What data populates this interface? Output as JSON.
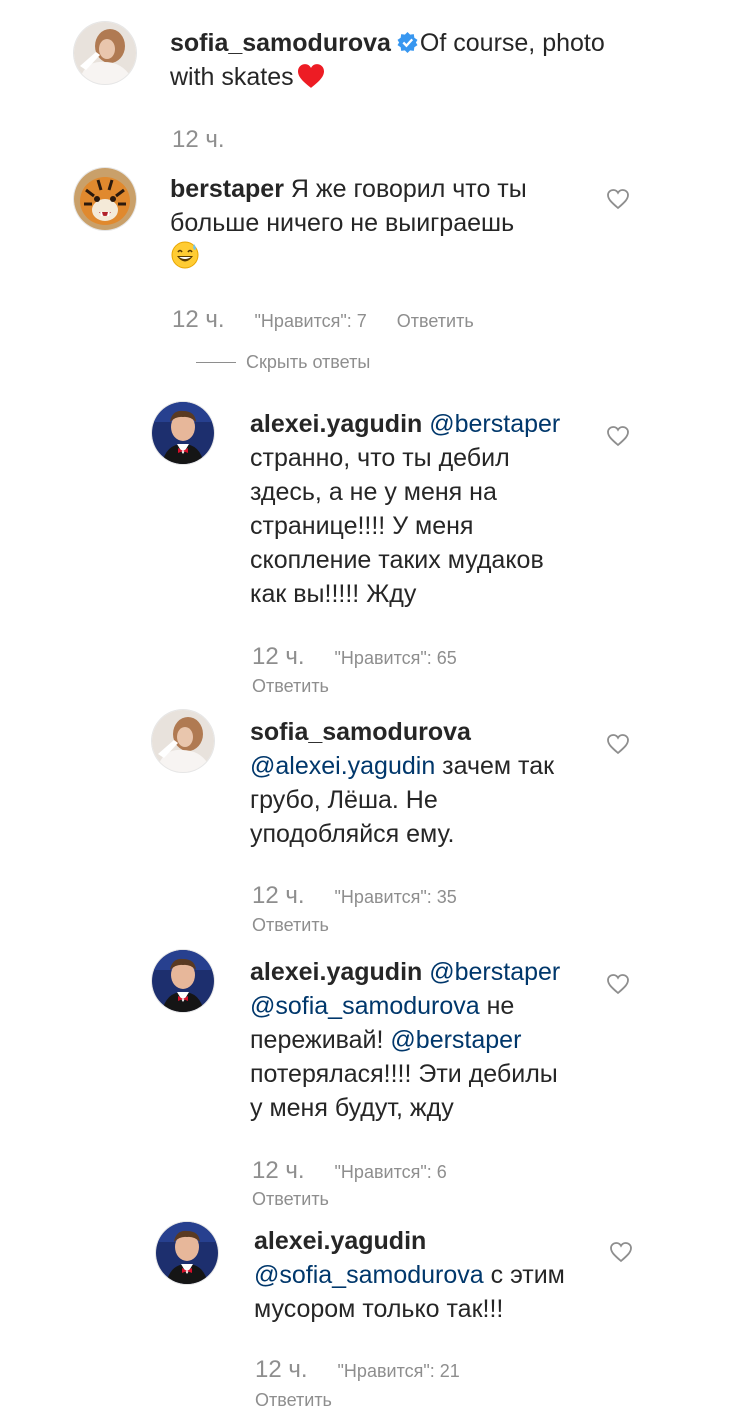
{
  "comments": [
    {
      "username": "sofia_samodurova",
      "text": "Of course, photo with skates",
      "time": "12 ч."
    },
    {
      "username": "berstaper",
      "text": "Я же говорил что ты больше ничего не выиграешь",
      "time": "12 ч.",
      "likes": "\"Нравится\": 7",
      "reply": "Ответить"
    }
  ],
  "hide_replies": "Скрыть ответы",
  "replies": [
    {
      "username": "alexei.yagudin",
      "mention": "@berstaper",
      "line1_rest": "",
      "lines": [
        "странно, что ты дебил",
        "здесь, а не у меня на",
        "странице!!!! У меня",
        "скопление таких мудаков",
        "как вы!!!!! Жду"
      ],
      "time": "12 ч.",
      "likes": "\"Нравится\": 65",
      "reply": "Ответить"
    },
    {
      "username": "sofia_samodurova",
      "mention": "@alexei.yagudin",
      "line1_rest": " зачем так",
      "lines": [
        "грубо, Лёша. Не",
        "уподобляйся ему."
      ],
      "time": "12 ч.",
      "likes": "\"Нравится\": 35",
      "reply": "Ответить"
    },
    {
      "username": "alexei.yagudin",
      "mention": "@berstaper",
      "mention2": "@sofia_samodurova",
      "mention2_rest": " не",
      "line3_start": "переживай! ",
      "mention3": "@berstaper",
      "lines": [
        "потерялася!!!! Эти дебилы",
        "у меня будут, жду"
      ],
      "time": "12 ч.",
      "likes": "\"Нравится\": 6",
      "reply": "Ответить"
    },
    {
      "username": "alexei.yagudin",
      "mention": "@sofia_samodurova",
      "line1_rest": " с этим",
      "lines": [
        "мусором только так!!!"
      ],
      "time": "12 ч.",
      "likes": "\"Нравится\": 21",
      "reply": "Ответить"
    }
  ],
  "colors": {
    "text": "#262626",
    "meta": "#8e8e8e",
    "mention": "#00376b",
    "verified": "#3897f0",
    "heart_emoji": "#ed1c24"
  },
  "icons": [
    "verified-badge-icon",
    "red-heart-emoji",
    "grinning-sweat-emoji",
    "heart-outline-icon"
  ]
}
